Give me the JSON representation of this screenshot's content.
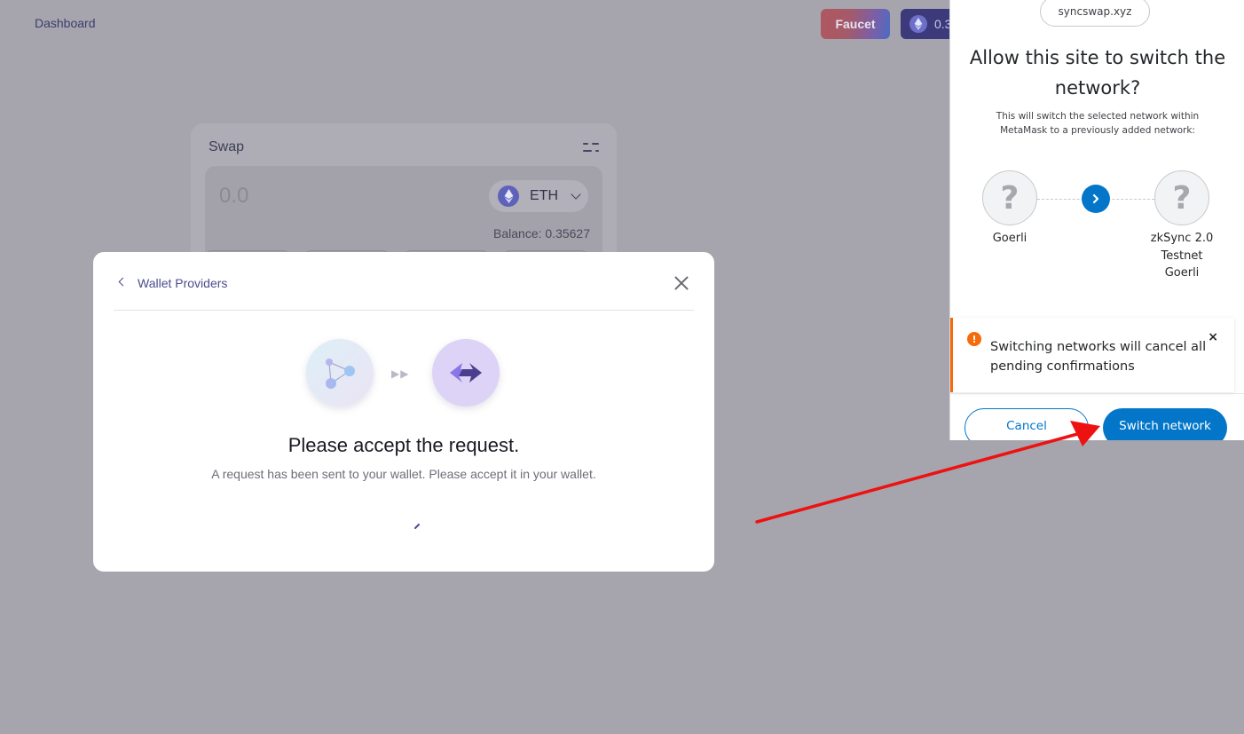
{
  "nav": {
    "dashboard": "Dashboard",
    "faucet": "Faucet",
    "balance_partial": "0.3"
  },
  "swap": {
    "title": "Swap",
    "amount": "0.0",
    "token": "ETH",
    "balance": "Balance: 0.35627"
  },
  "modal": {
    "back_label": "Wallet Providers",
    "title": "Please accept the request.",
    "description": "A request has been sent to your wallet. Please accept it in your wallet.",
    "arrows": "▶▶"
  },
  "metamask": {
    "origin": "syncswap.xyz",
    "title": "Allow this site to switch the network?",
    "description": "This will switch the selected network within MetaMask to a previously added network:",
    "from_network": "Goerli",
    "to_network": "zkSync 2.0 Testnet Goerli",
    "unknown_glyph": "?",
    "warning": "Switching networks will cancel all pending confirmations",
    "warning_icon": "!",
    "close_glyph": "×",
    "cancel": "Cancel",
    "switch": "Switch network"
  },
  "colors": {
    "accent": "#0376c9",
    "warning": "#f66a0a",
    "annotation": "#ee1111"
  }
}
